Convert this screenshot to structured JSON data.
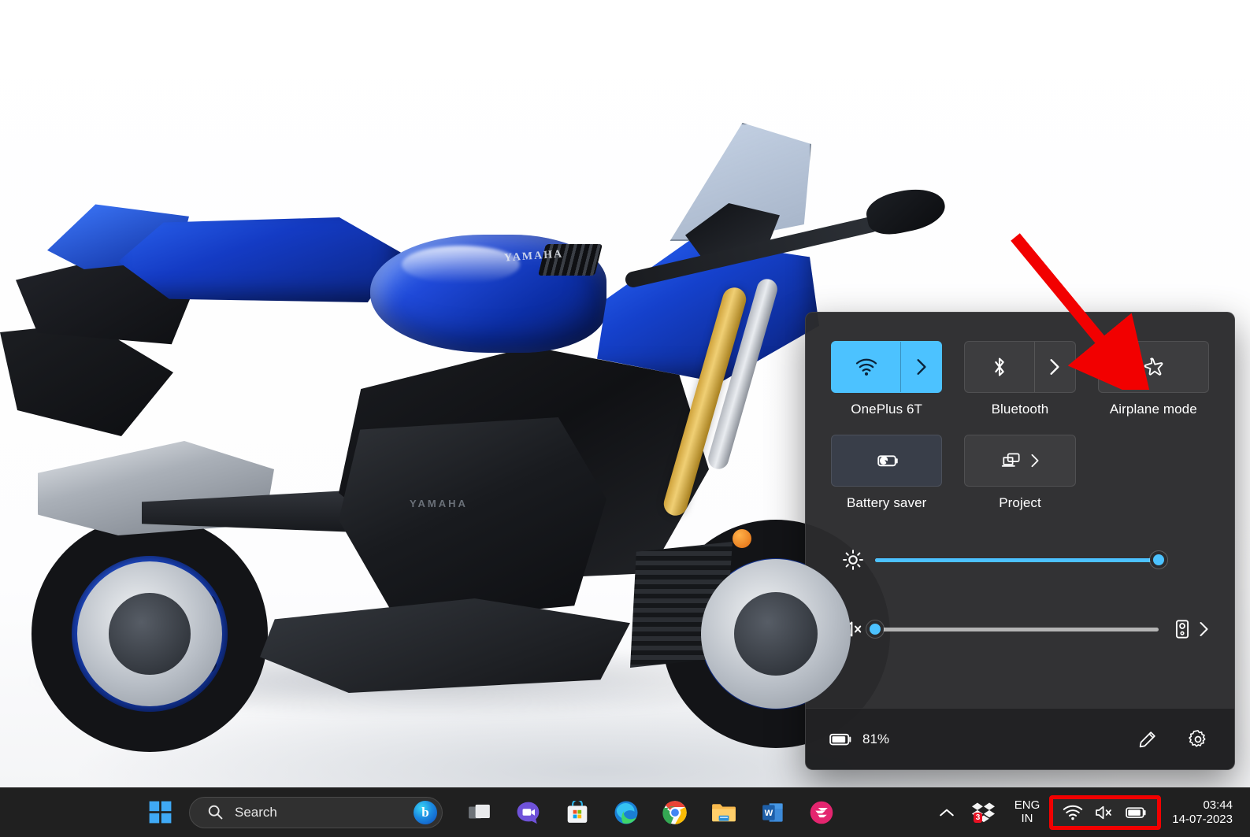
{
  "desktop": {
    "wallpaper_description": "Blue Yamaha YZF-R1 sport motorcycle on white background",
    "bike_tank_logo": "YAMAHA",
    "bike_engine_logo": "YAMAHA"
  },
  "quick_settings": {
    "tiles": [
      {
        "label": "OnePlus 6T",
        "icon": "wifi-icon",
        "state": "on",
        "has_chevron": true,
        "accent": "#4cc2ff"
      },
      {
        "label": "Bluetooth",
        "icon": "bluetooth-icon",
        "state": "off",
        "has_chevron": true
      },
      {
        "label": "Airplane mode",
        "icon": "airplane-icon",
        "state": "off",
        "has_chevron": false
      },
      {
        "label": "Battery saver",
        "icon": "battery-saver-icon",
        "state": "off",
        "has_chevron": false
      },
      {
        "label": "Project",
        "icon": "project-icon",
        "state": "off",
        "has_chevron": true
      }
    ],
    "brightness": {
      "icon": "brightness-icon",
      "value": 100,
      "aria": "Brightness"
    },
    "volume": {
      "icon": "volume-mute-icon",
      "value": 0,
      "aria": "Volume",
      "output_icon": "speaker-icon",
      "output_chevron": "chevron-right-icon"
    },
    "footer": {
      "battery_icon": "battery-icon",
      "battery_percent": "81%",
      "edit_label": "Edit quick settings",
      "settings_label": "All settings"
    }
  },
  "annotation": {
    "type": "red-arrow",
    "points_to": "Airplane mode",
    "color": "#f20000"
  },
  "taskbar": {
    "start_label": "Start",
    "search": {
      "placeholder": "Search",
      "value": "Search",
      "icon": "search-icon",
      "bing_icon": "bing-icon",
      "bing_glyph": "b"
    },
    "apps": [
      {
        "name": "task-view",
        "label": "Task view"
      },
      {
        "name": "chat",
        "label": "Chat"
      },
      {
        "name": "microsoft-store",
        "label": "Microsoft Store"
      },
      {
        "name": "microsoft-edge",
        "label": "Microsoft Edge"
      },
      {
        "name": "google-chrome",
        "label": "Google Chrome"
      },
      {
        "name": "file-explorer",
        "label": "File Explorer"
      },
      {
        "name": "microsoft-word",
        "label": "Microsoft Word"
      },
      {
        "name": "swift-app",
        "label": "Swift"
      }
    ],
    "tray": {
      "overflow_icon": "chevron-up-icon",
      "dropbox": {
        "icon": "dropbox-icon",
        "badge": "3"
      },
      "language": {
        "line1": "ENG",
        "line2": "IN"
      },
      "status_icons": [
        {
          "name": "wifi-icon",
          "label": "Network"
        },
        {
          "name": "volume-mute-icon",
          "label": "Volume muted"
        },
        {
          "name": "battery-icon",
          "label": "Battery"
        }
      ],
      "clock": {
        "time": "03:44",
        "date": "14-07-2023"
      }
    }
  }
}
